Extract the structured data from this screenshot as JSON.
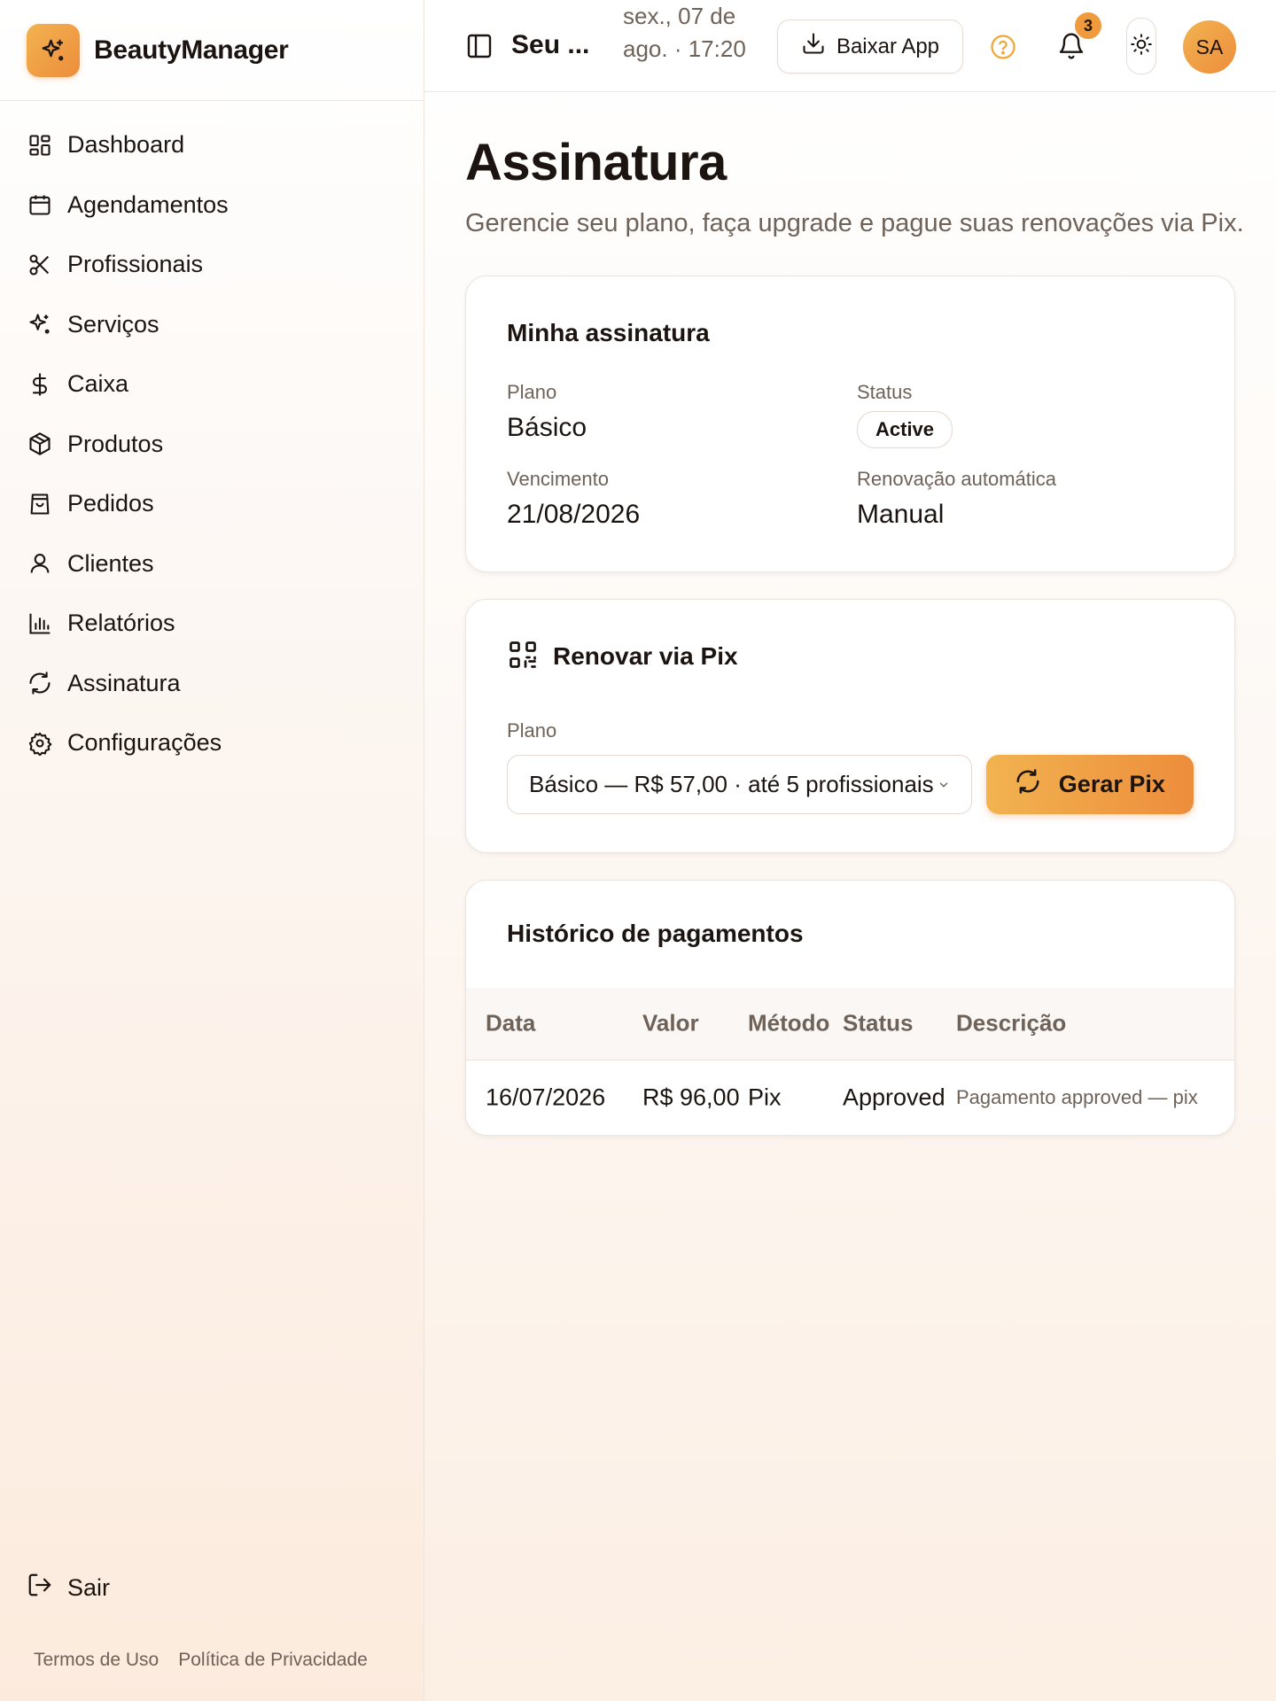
{
  "brand": {
    "name": "BeautyManager"
  },
  "sidebar": {
    "items": [
      {
        "label": "Dashboard",
        "icon": "dashboard-icon"
      },
      {
        "label": "Agendamentos",
        "icon": "calendar-icon"
      },
      {
        "label": "Profissionais",
        "icon": "scissors-icon"
      },
      {
        "label": "Serviços",
        "icon": "sparkles-icon"
      },
      {
        "label": "Caixa",
        "icon": "dollar-icon"
      },
      {
        "label": "Produtos",
        "icon": "box-icon"
      },
      {
        "label": "Pedidos",
        "icon": "shopping-bag-icon"
      },
      {
        "label": "Clientes",
        "icon": "user-icon"
      },
      {
        "label": "Relatórios",
        "icon": "bar-chart-icon"
      },
      {
        "label": "Assinatura",
        "icon": "refresh-icon"
      },
      {
        "label": "Configurações",
        "icon": "gear-icon"
      }
    ],
    "logout": "Sair",
    "terms": "Termos de Uso",
    "privacy": "Política de Privacidade"
  },
  "topbar": {
    "shop_name": "Seu ...",
    "datetime": "sex., 07 de ago. · 17:20",
    "download_label": "Baixar App",
    "notification_count": "3",
    "avatar_initials": "SA"
  },
  "page": {
    "title": "Assinatura",
    "subtitle": "Gerencie seu plano, faça upgrade e pague suas renovações via Pix."
  },
  "subscription": {
    "title": "Minha assinatura",
    "plan_label": "Plano",
    "plan_value": "Básico",
    "status_label": "Status",
    "status_value": "Active",
    "due_label": "Vencimento",
    "due_value": "21/08/2026",
    "renewal_label": "Renovação automática",
    "renewal_value": "Manual"
  },
  "pix": {
    "title": "Renovar via Pix",
    "plan_label": "Plano",
    "selected_plan": "Básico — R$ 57,00 · até 5 profissionais",
    "button_label": "Gerar Pix"
  },
  "history": {
    "title": "Histórico de pagamentos",
    "columns": [
      "Data",
      "Valor",
      "Método",
      "Status",
      "Descrição"
    ],
    "rows": [
      {
        "date": "16/07/2026",
        "amount": "R$ 96,00",
        "method": "Pix",
        "status": "Approved",
        "description": "Pagamento approved — pix"
      }
    ]
  },
  "colors": {
    "accent_start": "#f2b350",
    "accent_end": "#ed8d3c",
    "text": "#1c1410",
    "muted": "#6f6259"
  }
}
